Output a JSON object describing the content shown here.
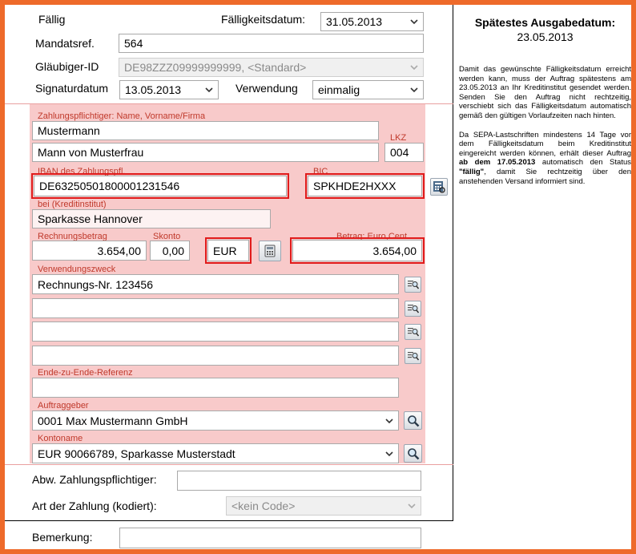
{
  "header": {
    "faellig_label": "Fällig",
    "faelligkeitsdatum_label": "Fälligkeitsdatum:",
    "faelligkeitsdatum_value": "31.05.2013",
    "mandatsref_label": "Mandatsref.",
    "mandatsref_value": "564",
    "glaeubiger_label": "Gläubiger-ID",
    "glaeubiger_value": "DE98ZZZ09999999999, <Standard>",
    "signaturdatum_label": "Signaturdatum",
    "signaturdatum_value": "13.05.2013",
    "verwendung_label": "Verwendung",
    "verwendung_value": "einmalig"
  },
  "payer": {
    "name_label": "Zahlungspflichtiger: Name, Vorname/Firma",
    "name_line1": "Mustermann",
    "name_line2": "Mann von Musterfrau",
    "lkz_label": "LKZ",
    "lkz_value": "004",
    "iban_label": "IBAN des Zahlungspfl.",
    "iban_value": "DE63250501800001231546",
    "bic_label": "BIC",
    "bic_value": "SPKHDE2HXXX",
    "bank_label": "bei (Kreditinstitut)",
    "bank_value": "Sparkasse Hannover"
  },
  "amounts": {
    "rechnungsbetrag_label": "Rechnungsbetrag",
    "rechnungsbetrag_value": "3.654,00",
    "skonto_label": "Skonto",
    "skonto_value": "0,00",
    "currency_value": "EUR",
    "betrag_label": "Betrag: Euro,Cent",
    "betrag_value": "3.654,00"
  },
  "purpose": {
    "label": "Verwendungszweck",
    "lines": [
      "Rechnungs-Nr. 123456",
      "",
      "",
      ""
    ],
    "e2e_label": "Ende-zu-Ende-Referenz",
    "e2e_value": ""
  },
  "creditor": {
    "auftraggeber_label": "Auftraggeber",
    "auftraggeber_value": "0001 Max Mustermann GmbH",
    "kontoname_label": "Kontoname",
    "kontoname_value": "EUR 90066789, Sparkasse Musterstadt"
  },
  "footer": {
    "abw_label": "Abw. Zahlungspflichtiger:",
    "abw_value": "",
    "art_label": "Art der Zahlung (kodiert):",
    "art_value": "<kein Code>",
    "bemerkung_label": "Bemerkung:",
    "bemerkung_value": ""
  },
  "info": {
    "title": "Spätestes Ausgabedatum:",
    "date": "23.05.2013",
    "para1": "Damit das gewünschte Fälligkeitsdatum erreicht werden kann, muss der Auftrag spätestens am 23.05.2013 an Ihr Kreditinstitut gesendet werden. Senden Sie den Auftrag nicht rechtzeitig, verschiebt sich das Fälligkeitsdatum automatisch gemäß den gültigen Vorlaufzeiten nach hinten.",
    "para2_a": "Da SEPA-Lastschriften mindestens 14 Tage vor dem Fälligkeitsdatum beim Kreditinstitut eingereicht werden können, erhält dieser Auftrag ",
    "para2_b": "ab dem 17.05.2013",
    "para2_c": " automatisch den Status ",
    "para2_d": "\"fällig\"",
    "para2_e": ", damit Sie rechtzeitig über den anstehenden Versand informiert sind."
  },
  "icons": {
    "chevron": "chevron-down-icon",
    "calculator": "calculator-icon",
    "lookup": "lookup-icon",
    "search": "search-icon",
    "bank_lookup": "bank-lookup-icon"
  },
  "colors": {
    "frame": "#ee6a2a",
    "pink_section": "#f8caca",
    "required_red": "#e01b1b",
    "label_red": "#c0392b"
  }
}
